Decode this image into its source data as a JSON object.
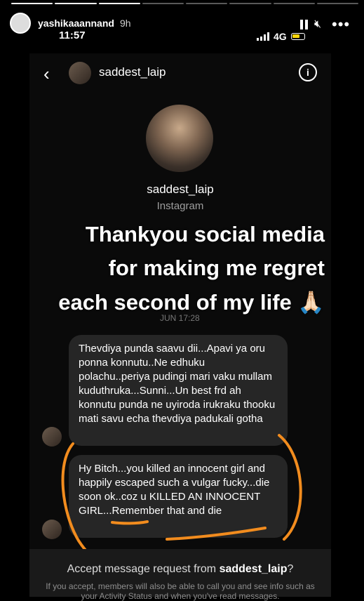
{
  "story": {
    "username": "yashikaaannand",
    "age": "9h",
    "segments": 8,
    "active_segment": 4
  },
  "status_bar": {
    "time": "11:57",
    "network": "4G"
  },
  "dm": {
    "username": "saddest_laip",
    "source": "Instagram",
    "timestamp": "JUN 17:28"
  },
  "caption": {
    "line1": "Thankyou social media",
    "line2": "for making me regret",
    "line3": "each second of my life 🙏🏻"
  },
  "messages": [
    {
      "text": "Thevdiya punda saavu dii...Apavi ya oru ponna konnutu..Ne edhuku polachu..periya pudingi mari vaku mullam kuduthruka...Sunni...Un best frd ah konnutu punda ne uyiroda irukraku thooku mati savu echa thevdiya padukali gotha"
    },
    {
      "text": "Hy Bitch...you killed an innocent girl and happily escaped such a vulgar fucky...die soon ok..coz u KILLED AN INNOCENT GIRL...Remember that and die"
    }
  ],
  "accept": {
    "prefix": "Accept message request from ",
    "username": "saddest_laip",
    "suffix": "?",
    "subtext": "If you accept, members will also be able to call you and see info such as your Activity Status and when you've read messages."
  },
  "colors": {
    "annotation": "#f28c1e",
    "bubble": "#262626",
    "background": "#000000"
  }
}
